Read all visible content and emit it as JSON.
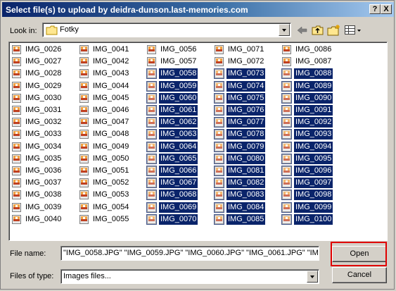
{
  "window": {
    "title": "Select file(s) to upload by deidra-dunson.last-memories.com",
    "help_label": "?",
    "close_label": "X"
  },
  "toolbar": {
    "lookin_label": "Look in:",
    "lookin_value": "Fotky",
    "icons": [
      "back-arrow-icon",
      "up-folder-icon",
      "new-folder-icon",
      "view-menu-icon"
    ]
  },
  "files": {
    "columns": [
      [
        {
          "name": "IMG_0026",
          "sel": false
        },
        {
          "name": "IMG_0027",
          "sel": false
        },
        {
          "name": "IMG_0028",
          "sel": false
        },
        {
          "name": "IMG_0029",
          "sel": false
        },
        {
          "name": "IMG_0030",
          "sel": false
        },
        {
          "name": "IMG_0031",
          "sel": false
        },
        {
          "name": "IMG_0032",
          "sel": false
        },
        {
          "name": "IMG_0033",
          "sel": false
        },
        {
          "name": "IMG_0034",
          "sel": false
        },
        {
          "name": "IMG_0035",
          "sel": false
        },
        {
          "name": "IMG_0036",
          "sel": false
        },
        {
          "name": "IMG_0037",
          "sel": false
        },
        {
          "name": "IMG_0038",
          "sel": false
        },
        {
          "name": "IMG_0039",
          "sel": false
        },
        {
          "name": "IMG_0040",
          "sel": false
        }
      ],
      [
        {
          "name": "IMG_0041",
          "sel": false
        },
        {
          "name": "IMG_0042",
          "sel": false
        },
        {
          "name": "IMG_0043",
          "sel": false
        },
        {
          "name": "IMG_0044",
          "sel": false
        },
        {
          "name": "IMG_0045",
          "sel": false
        },
        {
          "name": "IMG_0046",
          "sel": false
        },
        {
          "name": "IMG_0047",
          "sel": false
        },
        {
          "name": "IMG_0048",
          "sel": false
        },
        {
          "name": "IMG_0049",
          "sel": false
        },
        {
          "name": "IMG_0050",
          "sel": false
        },
        {
          "name": "IMG_0051",
          "sel": false
        },
        {
          "name": "IMG_0052",
          "sel": false
        },
        {
          "name": "IMG_0053",
          "sel": false
        },
        {
          "name": "IMG_0054",
          "sel": false
        },
        {
          "name": "IMG_0055",
          "sel": false
        }
      ],
      [
        {
          "name": "IMG_0056",
          "sel": false
        },
        {
          "name": "IMG_0057",
          "sel": false
        },
        {
          "name": "IMG_0058",
          "sel": true
        },
        {
          "name": "IMG_0059",
          "sel": true
        },
        {
          "name": "IMG_0060",
          "sel": true
        },
        {
          "name": "IMG_0061",
          "sel": true
        },
        {
          "name": "IMG_0062",
          "sel": true
        },
        {
          "name": "IMG_0063",
          "sel": true
        },
        {
          "name": "IMG_0064",
          "sel": true
        },
        {
          "name": "IMG_0065",
          "sel": true
        },
        {
          "name": "IMG_0066",
          "sel": true
        },
        {
          "name": "IMG_0067",
          "sel": true
        },
        {
          "name": "IMG_0068",
          "sel": true
        },
        {
          "name": "IMG_0069",
          "sel": true
        },
        {
          "name": "IMG_0070",
          "sel": true
        }
      ],
      [
        {
          "name": "IMG_0071",
          "sel": false
        },
        {
          "name": "IMG_0072",
          "sel": false
        },
        {
          "name": "IMG_0073",
          "sel": true
        },
        {
          "name": "IMG_0074",
          "sel": true
        },
        {
          "name": "IMG_0075",
          "sel": true
        },
        {
          "name": "IMG_0076",
          "sel": true
        },
        {
          "name": "IMG_0077",
          "sel": true
        },
        {
          "name": "IMG_0078",
          "sel": true
        },
        {
          "name": "IMG_0079",
          "sel": true
        },
        {
          "name": "IMG_0080",
          "sel": true
        },
        {
          "name": "IMG_0081",
          "sel": true
        },
        {
          "name": "IMG_0082",
          "sel": true
        },
        {
          "name": "IMG_0083",
          "sel": true
        },
        {
          "name": "IMG_0084",
          "sel": true
        },
        {
          "name": "IMG_0085",
          "sel": true
        }
      ],
      [
        {
          "name": "IMG_0086",
          "sel": false
        },
        {
          "name": "IMG_0087",
          "sel": false
        },
        {
          "name": "IMG_0088",
          "sel": true
        },
        {
          "name": "IMG_0089",
          "sel": true
        },
        {
          "name": "IMG_0090",
          "sel": true
        },
        {
          "name": "IMG_0091",
          "sel": true
        },
        {
          "name": "IMG_0092",
          "sel": true
        },
        {
          "name": "IMG_0093",
          "sel": true
        },
        {
          "name": "IMG_0094",
          "sel": true
        },
        {
          "name": "IMG_0095",
          "sel": true
        },
        {
          "name": "IMG_0096",
          "sel": true
        },
        {
          "name": "IMG_0097",
          "sel": true
        },
        {
          "name": "IMG_0098",
          "sel": true
        },
        {
          "name": "IMG_0099",
          "sel": true
        },
        {
          "name": "IMG_0100",
          "sel": true
        }
      ]
    ]
  },
  "footer": {
    "filename_label": "File name:",
    "filename_value": "\"IMG_0058.JPG\" \"IMG_0059.JPG\" \"IMG_0060.JPG\" \"IMG_0061.JPG\" \"IM",
    "filetype_label": "Files of type:",
    "filetype_value": "Images files...",
    "open_label": "Open",
    "cancel_label": "Cancel"
  },
  "colors": {
    "title_start": "#0a246a",
    "title_end": "#a6caf0",
    "selection": "#0a246a",
    "face": "#d4d0c8",
    "highlight_box": "#e00000"
  }
}
